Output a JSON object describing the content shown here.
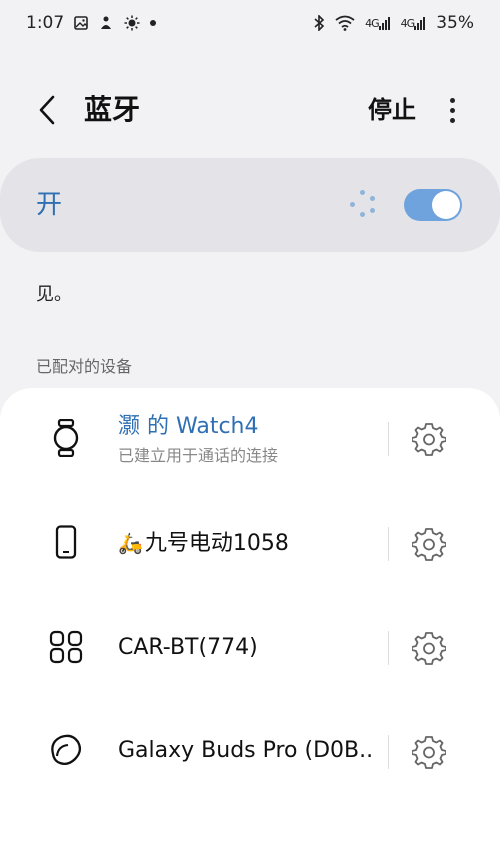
{
  "status_bar": {
    "time": "1:07",
    "battery": "35%",
    "signal_1": "4G",
    "signal_2": "4G",
    "left_icons": [
      "gallery-icon",
      "app-notification-icon",
      "brightness-icon",
      "dot-icon"
    ],
    "right_icons": [
      "bluetooth-icon",
      "wifi-icon",
      "signal-icon",
      "signal-icon"
    ]
  },
  "header": {
    "title": "蓝牙",
    "stop_label": "停止"
  },
  "toggle": {
    "label": "开",
    "state": "on",
    "accent": "#2f6fb3",
    "switch_color": "#6fa3dd"
  },
  "info_text": "见。",
  "paired_section": {
    "title": "已配对的设备",
    "devices": [
      {
        "name": "灏 的 Watch4",
        "subtitle": "已建立用于通话的连接",
        "icon": "watch-icon",
        "connected": true
      },
      {
        "name": "九号电动1058",
        "emoji": "🛵",
        "icon": "phone-icon",
        "connected": false
      },
      {
        "name": "CAR-BT(774)",
        "icon": "car-multimedia-icon",
        "connected": false
      },
      {
        "name": "Galaxy Buds Pro (D0B..",
        "icon": "earbuds-icon",
        "connected": false
      }
    ]
  }
}
